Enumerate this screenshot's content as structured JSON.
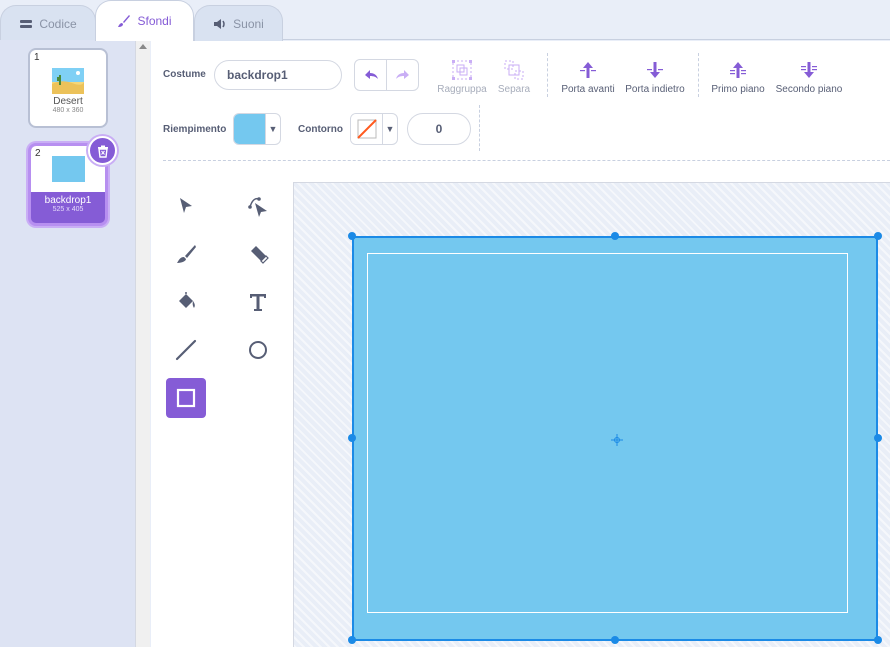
{
  "tabs": [
    {
      "label": "Codice",
      "icon": "code-icon"
    },
    {
      "label": "Sfondi",
      "icon": "paintbrush-icon"
    },
    {
      "label": "Suoni",
      "icon": "speaker-icon"
    }
  ],
  "backdrops": [
    {
      "index": "1",
      "name": "Desert",
      "size": "480 x 360"
    },
    {
      "index": "2",
      "name": "backdrop1",
      "size": "525 x 405"
    }
  ],
  "toolbar": {
    "costume_label": "Costume",
    "costume_name": "backdrop1",
    "group_label": "Raggruppa",
    "ungroup_label": "Separa",
    "forward_label": "Porta avanti",
    "backward_label": "Porta indietro",
    "front_label": "Primo piano",
    "back_label": "Secondo piano",
    "fill_label": "Riempimento",
    "outline_label": "Contorno",
    "outline_width": "0"
  },
  "colors": {
    "accent": "#855cd6",
    "fill": "#74c8ef",
    "selection": "#1b8ae6"
  },
  "tools": [
    "select-tool",
    "reshape-tool",
    "brush-tool",
    "eraser-tool",
    "fill-tool",
    "text-tool",
    "line-tool",
    "circle-tool",
    "rectangle-tool"
  ],
  "selected_tool": "rectangle-tool"
}
